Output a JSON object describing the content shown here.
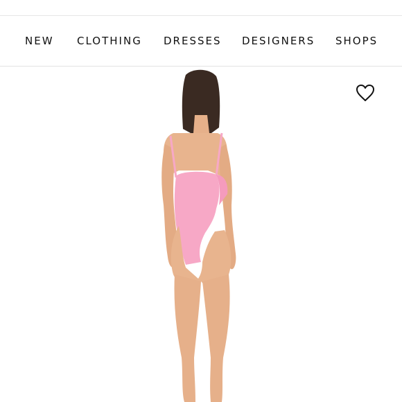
{
  "nav": {
    "items": [
      {
        "label": "NEW"
      },
      {
        "label": "CLOTHING"
      },
      {
        "label": "DRESSES"
      },
      {
        "label": "DESIGNERS"
      },
      {
        "label": "SHOPS"
      }
    ]
  },
  "product": {
    "image_subject": "model-back-view-pink-bodysuit",
    "favorite_icon": "heart-outline-icon"
  },
  "colors": {
    "background": "#ffffff",
    "text": "#111111",
    "bodysuit": "#f7a8c6",
    "skin": "#e8b48e",
    "hair": "#3a2a22"
  }
}
